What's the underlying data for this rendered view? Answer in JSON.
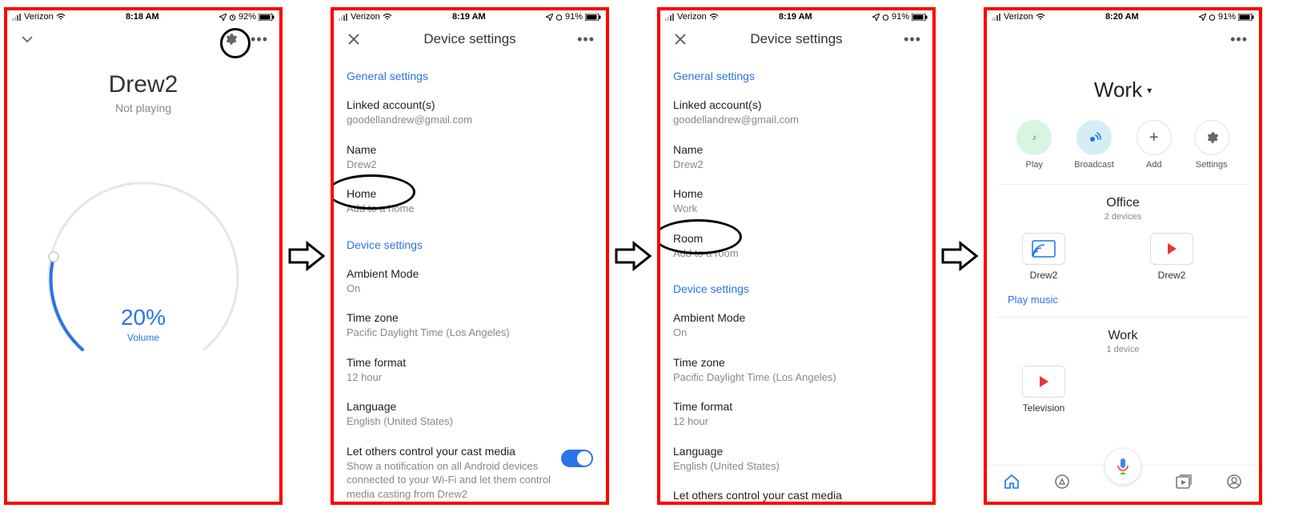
{
  "status": {
    "carrier": "Verizon",
    "s1": {
      "time": "8:18 AM",
      "battery": "92%"
    },
    "s2": {
      "time": "8:19 AM",
      "battery": "91%"
    },
    "s3": {
      "time": "8:19 AM",
      "battery": "91%"
    },
    "s4": {
      "time": "8:20 AM",
      "battery": "91%"
    }
  },
  "s1": {
    "device_name": "Drew2",
    "playing_status": "Not playing",
    "volume_pct": "20%",
    "volume_label": "Volume"
  },
  "s2": {
    "header_title": "Device settings",
    "section_general": "General settings",
    "linked_label": "Linked account(s)",
    "linked_value": "goodellandrew@gmail.com",
    "name_label": "Name",
    "name_value": "Drew2",
    "home_label": "Home",
    "home_value": "Add to a home",
    "section_device": "Device settings",
    "ambient_label": "Ambient Mode",
    "ambient_value": "On",
    "tz_label": "Time zone",
    "tz_value": "Pacific Daylight Time (Los Angeles)",
    "tf_label": "Time format",
    "tf_value": "12 hour",
    "lang_label": "Language",
    "lang_value": "English (United States)",
    "cast_label": "Let others control your cast media",
    "cast_value": "Show a notification on all Android devices connected to your Wi-Fi and let them control media casting from Drew2"
  },
  "s3": {
    "header_title": "Device settings",
    "section_general": "General settings",
    "linked_label": "Linked account(s)",
    "linked_value": "goodellandrew@gmail.com",
    "name_label": "Name",
    "name_value": "Drew2",
    "home_label": "Home",
    "home_value": "Work",
    "room_label": "Room",
    "room_value": "Add to a room",
    "section_device": "Device settings",
    "ambient_label": "Ambient Mode",
    "ambient_value": "On",
    "tz_label": "Time zone",
    "tz_value": "Pacific Daylight Time (Los Angeles)",
    "tf_label": "Time format",
    "tf_value": "12 hour",
    "lang_label": "Language",
    "lang_value": "English (United States)",
    "cast_label": "Let others control your cast media"
  },
  "s4": {
    "home_name": "Work",
    "actions": {
      "play": "Play",
      "broadcast": "Broadcast",
      "add": "Add",
      "settings": "Settings"
    },
    "group1": {
      "title": "Office",
      "sub": "2 devices",
      "dev1": "Drew2",
      "dev2": "Drew2"
    },
    "play_music": "Play music",
    "group2": {
      "title": "Work",
      "sub": "1 device",
      "dev1": "Television"
    }
  }
}
